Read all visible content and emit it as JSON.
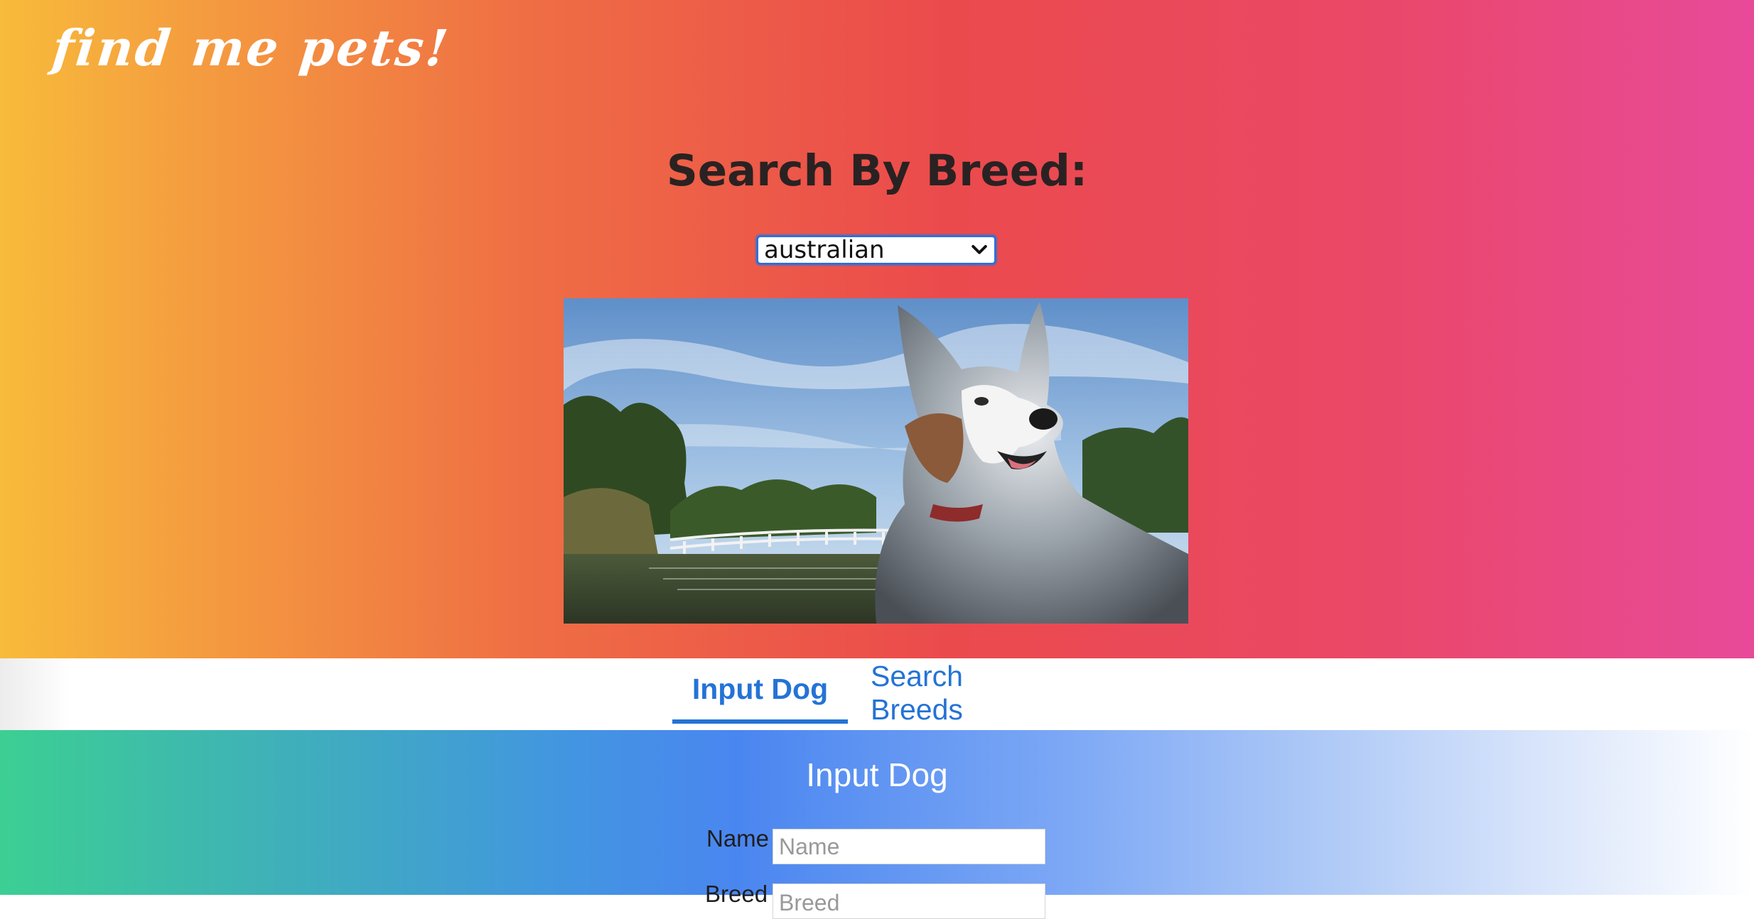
{
  "brand": {
    "logo_text": "find me pets!"
  },
  "search": {
    "title": "Search By Breed:",
    "selected_breed": "australian"
  },
  "photo": {
    "subject": "australian shepherd dog by a pond with a white bridge"
  },
  "tabs": [
    {
      "label": "Input Dog",
      "active": true
    },
    {
      "label": "Search Breeds",
      "active": false
    }
  ],
  "form": {
    "title": "Input Dog",
    "fields": [
      {
        "label": "Name",
        "placeholder": "Name"
      },
      {
        "label": "Breed",
        "placeholder": "Breed"
      }
    ]
  },
  "colors": {
    "accent": "#2473d6",
    "hero_gradient": [
      "#f8bb3a",
      "#ef6e44",
      "#eb4a4c",
      "#e84a9a"
    ],
    "form_gradient": [
      "#3ccf93",
      "#4a86f0",
      "#ffffff"
    ]
  },
  "icons": {
    "select_arrow": "chevron-down-icon"
  }
}
